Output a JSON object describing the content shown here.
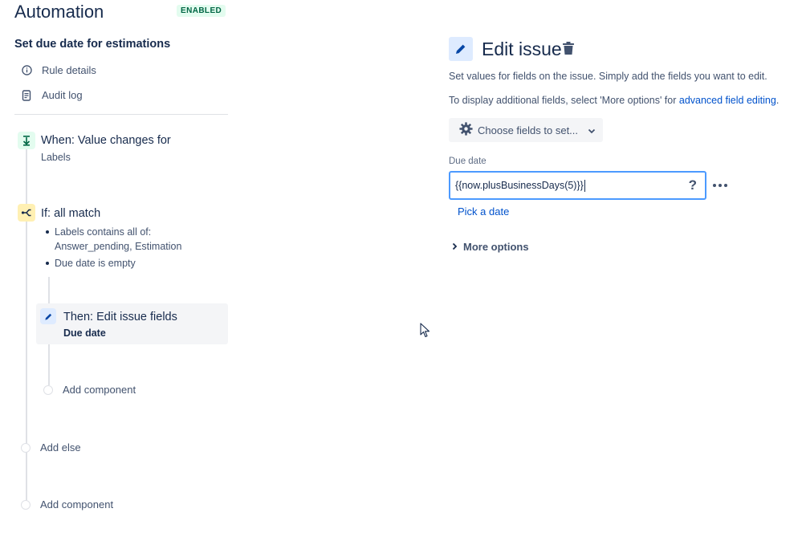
{
  "header": {
    "title": "Automation",
    "status_badge": "ENABLED"
  },
  "rule": {
    "name": "Set due date for estimations",
    "nav": [
      {
        "label": "Rule details",
        "icon": "info-icon"
      },
      {
        "label": "Audit log",
        "icon": "document-icon"
      }
    ]
  },
  "components": {
    "trigger": {
      "title": "When: Value changes for",
      "subtitle": "Labels",
      "icon": "trigger-icon"
    },
    "condition": {
      "title": "If: all match",
      "icon": "branch-icon",
      "items": [
        {
          "line1": "Labels contains all of:",
          "line2": "Answer_pending, Estimation"
        },
        {
          "line1": "Due date is empty"
        }
      ]
    },
    "action": {
      "title": "Then: Edit issue fields",
      "subtitle": "Due date",
      "icon": "pencil-icon"
    },
    "add_component_inner": "Add component",
    "add_else": "Add else",
    "add_component_outer": "Add component"
  },
  "editor": {
    "title": "Edit issue",
    "description": "Set values for fields on the issue. Simply add the fields you want to edit.",
    "display_prefix": "To display additional fields, select 'More options' for ",
    "display_link": "advanced field editing",
    "display_suffix": ".",
    "choose_fields_label": "Choose fields to set...",
    "field": {
      "label": "Due date",
      "value": "{{now.plusBusinessDays(5)}}",
      "help": "?"
    },
    "pick_date": "Pick a date",
    "more_options": "More options"
  },
  "colors": {
    "accent": "#0052cc",
    "badge_text": "#006644",
    "badge_bg": "#e3fcef",
    "trigger_icon_bg": "#e3fcef",
    "condition_icon_bg": "#fff0b3",
    "action_icon_bg": "#deebff",
    "focus_border": "#4c9aff"
  }
}
